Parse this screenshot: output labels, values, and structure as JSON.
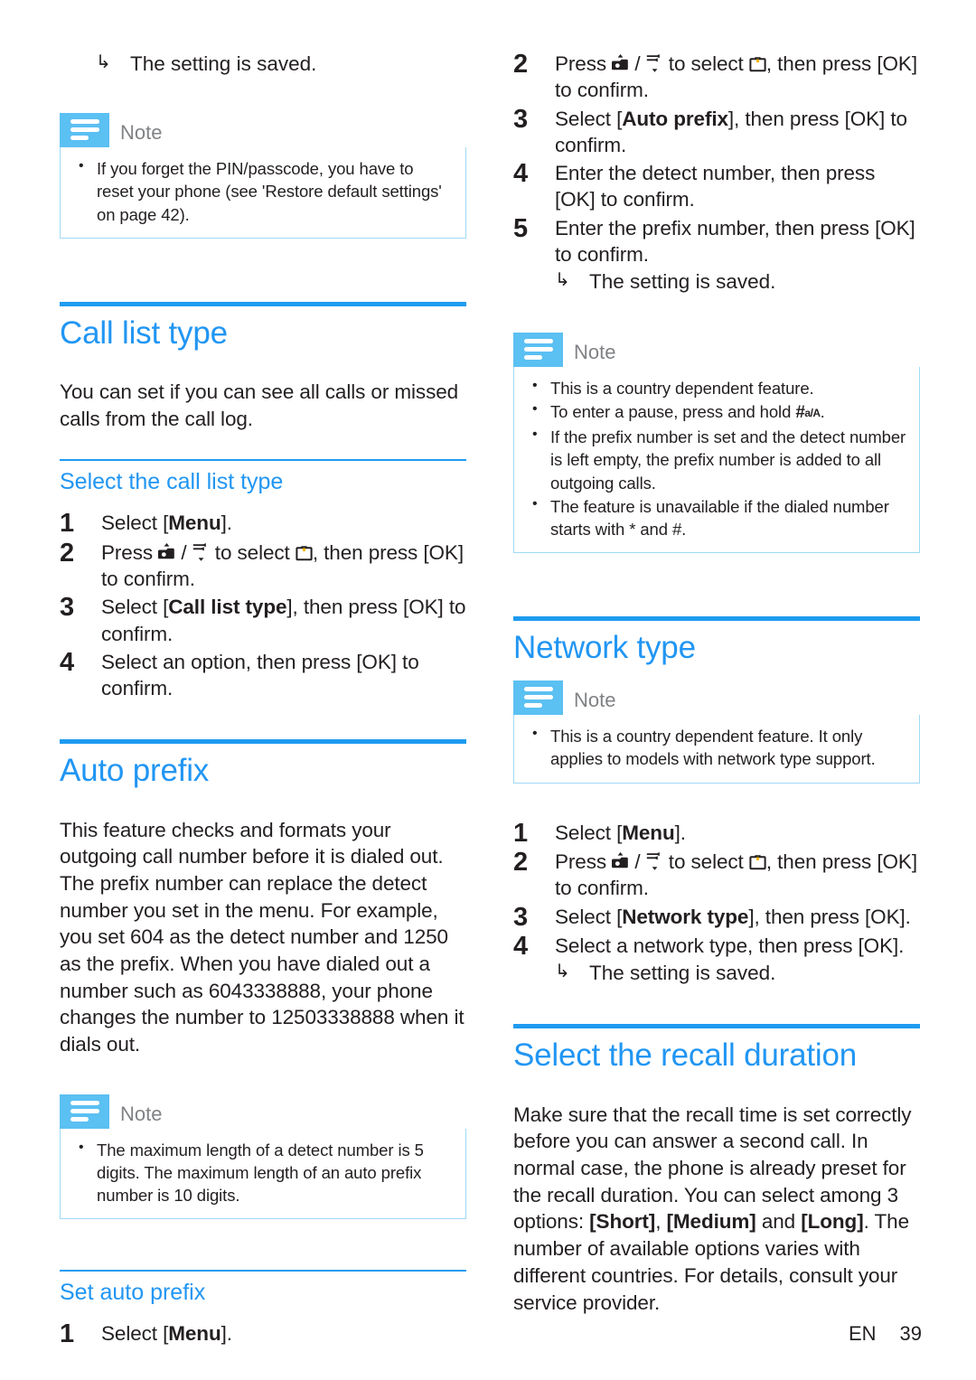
{
  "document": {
    "footer": {
      "language": "EN",
      "page_number": "39"
    },
    "note_label": "Note",
    "result_arrow": "↳"
  },
  "left_column": {
    "top_result": "The setting is saved.",
    "note_pin": {
      "label": "Note",
      "bullets": [
        "If you forget the PIN/passcode, you have to reset your phone (see 'Restore default settings' on page 42)."
      ]
    },
    "call_list_type": {
      "title": "Call list type",
      "intro": "You can set if you can see all calls or missed calls from the call log.",
      "subsection": {
        "title": "Select the call list type",
        "steps": [
          {
            "num": "1",
            "text_pre": "Select [",
            "bold": "Menu",
            "text_post": "]."
          },
          {
            "num": "2",
            "text_pre": "Press ",
            "text_mid": " to select ",
            "text_post": ", then press [OK] to confirm."
          },
          {
            "num": "3",
            "text_pre": "Select [",
            "bold": "Call list type",
            "text_post": "], then press [OK] to confirm."
          },
          {
            "num": "4",
            "text_pre": "Select an option, then press [OK] to confirm."
          }
        ]
      }
    },
    "auto_prefix": {
      "title": "Auto prefix",
      "intro": "This feature checks and formats your outgoing call number before it is dialed out. The prefix number can replace the detect number you set in the menu. For example, you set 604 as the detect number and 1250 as the prefix. When you have dialed out a number such as 6043338888, your phone changes the number to 12503338888 when it dials out.",
      "note": {
        "label": "Note",
        "bullets": [
          "The maximum length of a detect number is 5 digits. The maximum length of an auto prefix number is 10 digits."
        ]
      },
      "subsection": {
        "title": "Set auto prefix",
        "steps": [
          {
            "num": "1",
            "text_pre": "Select [",
            "bold": "Menu",
            "text_post": "]."
          }
        ]
      }
    }
  },
  "right_column": {
    "auto_prefix_steps": [
      {
        "num": "2",
        "text_pre": "Press ",
        "text_mid": " to select ",
        "text_post": ", then press [OK] to confirm."
      },
      {
        "num": "3",
        "text_pre": "Select [",
        "bold": "Auto prefix",
        "text_post": "], then press [OK] to confirm."
      },
      {
        "num": "4",
        "text_pre": "Enter the detect number, then press [OK] to confirm."
      },
      {
        "num": "5",
        "text_pre": "Enter the prefix number, then press [OK] to confirm."
      }
    ],
    "auto_prefix_result": "The setting is saved.",
    "auto_prefix_note": {
      "label": "Note",
      "bullets": [
        "This is a country dependent feature.",
        "To enter a pause, press and hold #a/A.",
        "If the prefix number is set and the detect number is left empty, the prefix number is added to all outgoing calls.",
        "The feature is unavailable if the dialed number starts with * and #."
      ],
      "pause_bullet_pre": "To enter a pause, press and hold ",
      "pause_key": "#",
      "pause_key_sub": "a/A",
      "pause_bullet_post": "."
    },
    "network_type": {
      "title": "Network type",
      "note": {
        "label": "Note",
        "bullets": [
          "This is a country dependent feature. It only applies to models with network type support."
        ]
      },
      "steps": [
        {
          "num": "1",
          "text_pre": "Select [",
          "bold": "Menu",
          "text_post": "]."
        },
        {
          "num": "2",
          "text_pre": "Press ",
          "text_mid": " to select ",
          "text_post": ", then press [OK] to confirm."
        },
        {
          "num": "3",
          "text_pre": "Select [",
          "bold": "Network type",
          "text_post": "], then press [OK]."
        },
        {
          "num": "4",
          "text_pre": "Select a network type, then press [OK]."
        }
      ],
      "result": "The setting is saved."
    },
    "recall_duration": {
      "title": "Select the recall duration",
      "intro_pre": "Make sure that the recall time is set correctly before you can answer a second call. In normal case, the phone is already preset for the recall duration. You can select among 3 options: ",
      "option_1": "[Short]",
      "option_sep_1": ", ",
      "option_2": "[Medium]",
      "option_sep_2": " and ",
      "option_3": "[Long]",
      "intro_post": ". The number of available options varies with different countries. For details, consult your service provider."
    }
  },
  "colors": {
    "heading_blue": "#2196f3",
    "rule_blue": "#1e9bf0",
    "note_icon_blue": "#5bc0f2",
    "note_border_blue": "#9fd9f6",
    "body_text": "#231f20",
    "note_label_gray": "#808285",
    "key_accent_yellow": "#f5b800"
  },
  "icons": {
    "nav_up_key": "nav-up-key-icon",
    "nav_down_key": "nav-down-key-icon",
    "menu_key": "menu-briefcase-key-icon",
    "note_icon": "note-lines-icon",
    "result_arrow": "result-arrow-icon"
  }
}
